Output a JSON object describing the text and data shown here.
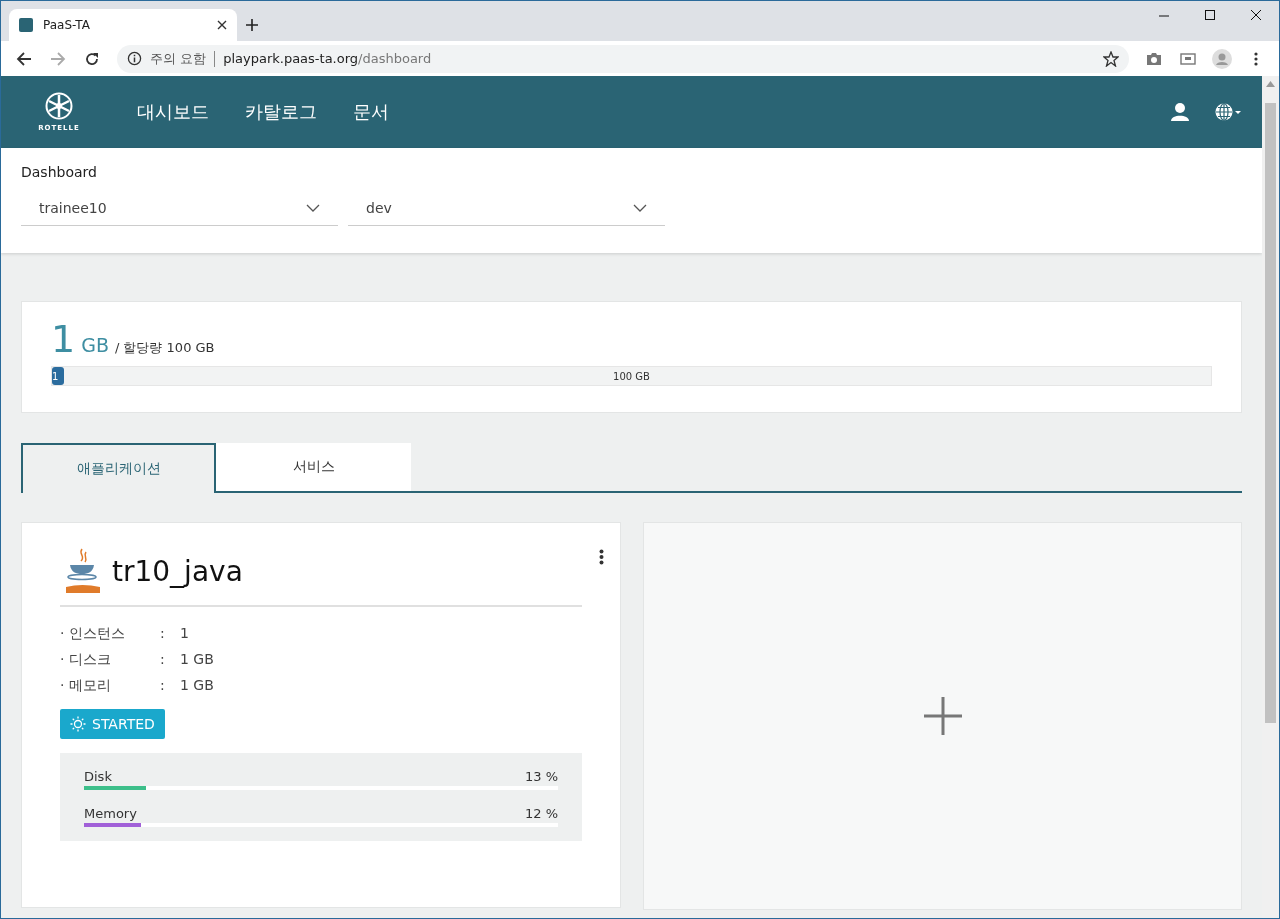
{
  "browser": {
    "tab_title": "PaaS-TA",
    "security_label": "주의 요함",
    "url_host": "playpark.paas-ta.org",
    "url_path": "/dashboard"
  },
  "header": {
    "logo_text": "ROTELLE",
    "nav": [
      {
        "label": "대시보드"
      },
      {
        "label": "카탈로그"
      },
      {
        "label": "문서"
      }
    ]
  },
  "dashboard": {
    "title": "Dashboard",
    "selects": [
      {
        "value": "trainee10"
      },
      {
        "value": "dev"
      }
    ]
  },
  "quota": {
    "used": "1",
    "unit": "GB",
    "allocation": "/ 할당량 100 GB",
    "level": 0.01,
    "fill_label": "1",
    "track_label": "100 GB"
  },
  "tabs": [
    {
      "label": "애플리케이션",
      "selected": true
    },
    {
      "label": "서비스",
      "selected": false
    }
  ],
  "app": {
    "name": "tr10_java",
    "details": [
      {
        "label": "· 인스턴스",
        "separator": ":",
        "value": "1"
      },
      {
        "label": "· 디스크",
        "separator": ":",
        "value": "1 GB"
      },
      {
        "label": "· 메모리",
        "separator": ":",
        "value": "1 GB"
      }
    ],
    "status": "STARTED",
    "meters": [
      {
        "name": "Disk",
        "reading": "13 %",
        "level": 0.13,
        "color": "#3dbf8a"
      },
      {
        "name": "Memory",
        "reading": "12 %",
        "level": 0.12,
        "color": "#a160d8"
      }
    ]
  }
}
